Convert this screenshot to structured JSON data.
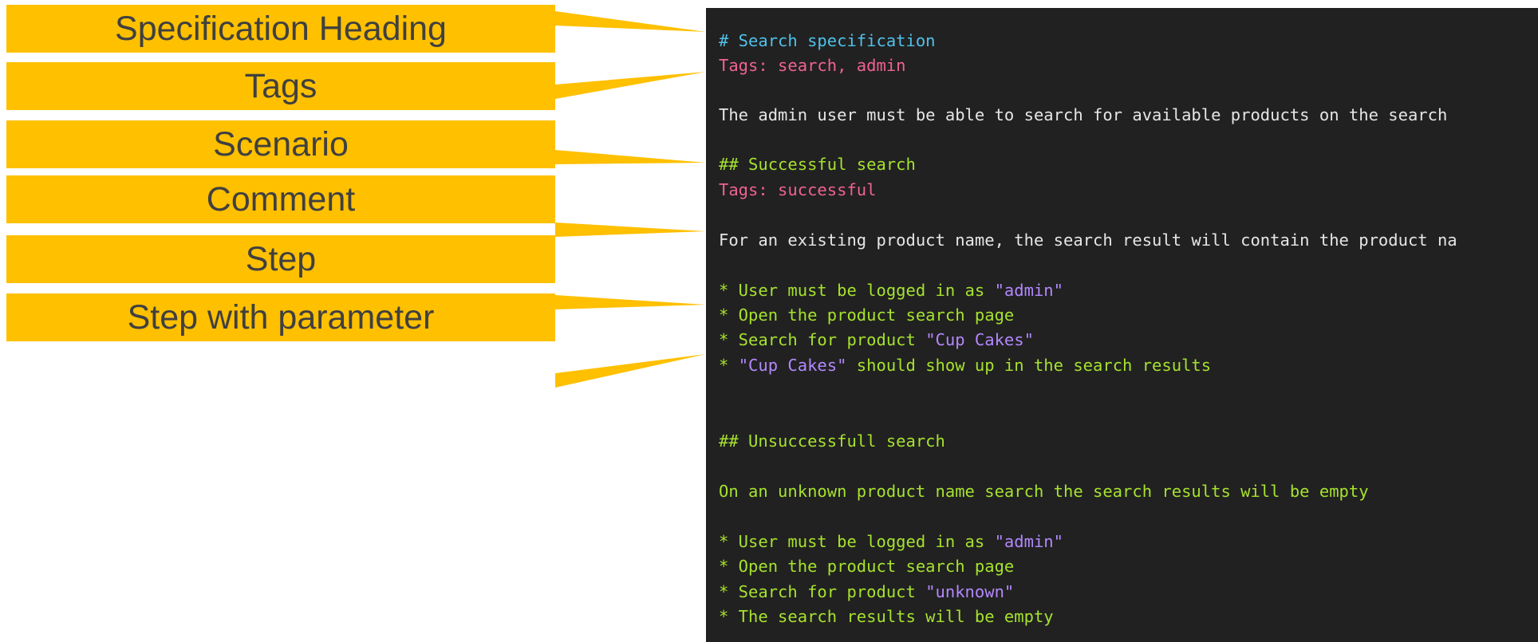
{
  "labels": [
    "Specification Heading",
    "Tags",
    "Scenario",
    "Comment",
    "Step",
    "Step with parameter"
  ],
  "colors": {
    "label_box": "#ffc000",
    "label_text": "#404040",
    "editor_bg": "#212121",
    "heading": "#4fc1e9",
    "tag": "#f06292",
    "plain_text": "#e6e6e6",
    "scenario_and_step": "#a6e22e",
    "parameter": "#b388ff"
  },
  "editor": {
    "spec_heading": "# Search specification",
    "spec_tags": "Tags: search, admin",
    "spec_description": "The admin user must be able to search for available products on the search",
    "scenario1": {
      "heading": "## Successful search",
      "tags": "Tags: successful",
      "comment": "For an existing product name, the search result will contain the product na",
      "steps": [
        {
          "pre": "* User must be logged in as ",
          "param": "\"admin\"",
          "post": ""
        },
        {
          "pre": "* Open the product search page",
          "param": "",
          "post": ""
        },
        {
          "pre": "* Search for product ",
          "param": "\"Cup Cakes\"",
          "post": ""
        },
        {
          "pre": "* ",
          "param": "\"Cup Cakes\"",
          "post": " should show up in the search results"
        }
      ]
    },
    "scenario2": {
      "heading": "## Unsuccessfull search",
      "comment": "On an unknown product name search the search results will be empty",
      "steps": [
        {
          "pre": "* User must be logged in as ",
          "param": "\"admin\"",
          "post": ""
        },
        {
          "pre": "* Open the product search page",
          "param": "",
          "post": ""
        },
        {
          "pre": "* Search for product ",
          "param": "\"unknown\"",
          "post": ""
        },
        {
          "pre": "* The search results will be empty",
          "param": "",
          "post": ""
        }
      ]
    }
  }
}
